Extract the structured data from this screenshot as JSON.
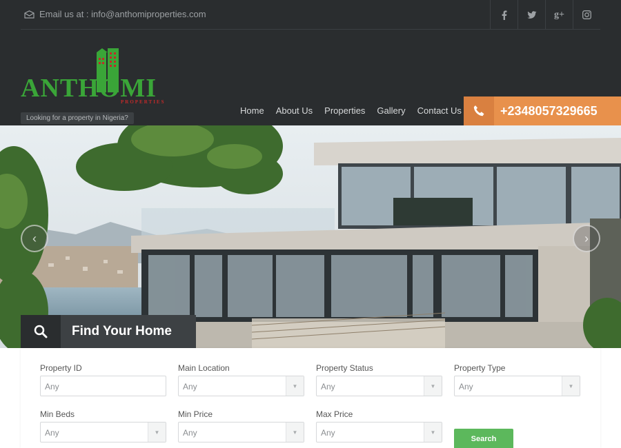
{
  "header": {
    "email_label": "Email us at : info@anthomiproperties.com",
    "social": [
      "f",
      "t",
      "g+",
      "ig"
    ],
    "social_icons": [
      "facebook-icon",
      "twitter-icon",
      "google-plus-icon",
      "instagram-icon"
    ],
    "logo_text": "ANTHOMI",
    "logo_sub": "PROPERTIES",
    "tagline": "Looking for a property in Nigeria?",
    "nav": [
      "Home",
      "About Us",
      "Properties",
      "Gallery",
      "Contact Us"
    ],
    "phone": "+2348057329665"
  },
  "colors": {
    "header_bg": "#2a2d2f",
    "accent_orange": "#e8914c",
    "logo_green": "#3aa538",
    "search_green": "#5cb85c"
  },
  "hero": {
    "find_title": "Find Your Home"
  },
  "form": {
    "fields": [
      {
        "label": "Property ID",
        "value": "Any",
        "type": "text"
      },
      {
        "label": "Main Location",
        "value": "Any",
        "type": "select"
      },
      {
        "label": "Property Status",
        "value": "Any",
        "type": "select"
      },
      {
        "label": "Property Type",
        "value": "Any",
        "type": "select"
      },
      {
        "label": "Min Beds",
        "value": "Any",
        "type": "select"
      },
      {
        "label": "Min Price",
        "value": "Any",
        "type": "select"
      },
      {
        "label": "Max Price",
        "value": "Any",
        "type": "select"
      }
    ],
    "search_label": "Search"
  }
}
